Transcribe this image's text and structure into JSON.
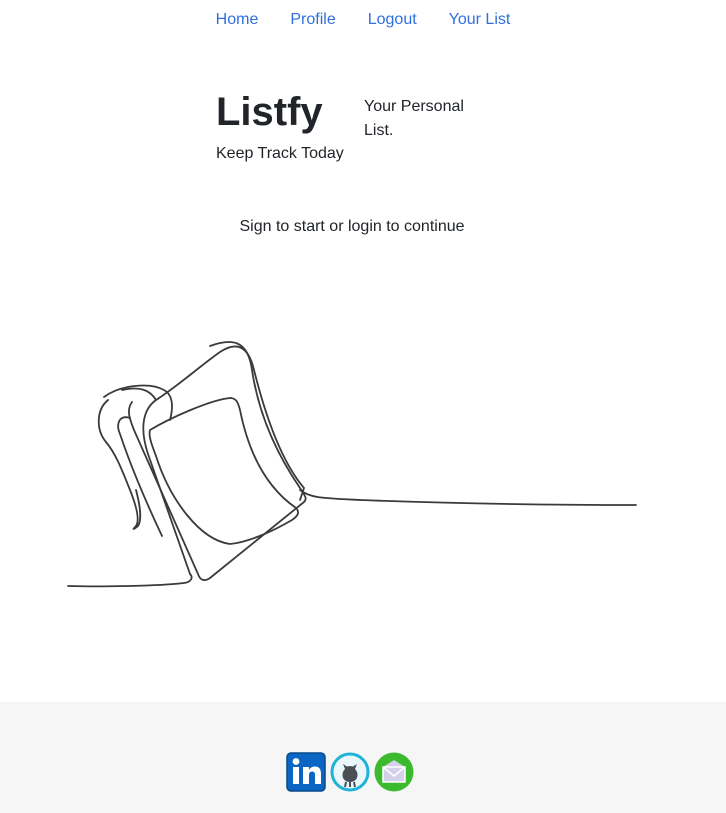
{
  "nav": {
    "items": [
      {
        "label": "Home"
      },
      {
        "label": "Profile"
      },
      {
        "label": "Logout"
      },
      {
        "label": "Your List"
      }
    ]
  },
  "brand": {
    "title": "Listfy",
    "subtitle": "Keep Track Today",
    "tagline": "Your Personal List."
  },
  "main": {
    "prompt": "Sign to start or login to continue"
  },
  "footer": {
    "social": [
      {
        "icon": "linkedin-icon",
        "color": "#0a66c2"
      },
      {
        "icon": "github-icon",
        "color": "#1fb3d6"
      },
      {
        "icon": "mail-icon",
        "color": "#3cba2e"
      }
    ]
  }
}
